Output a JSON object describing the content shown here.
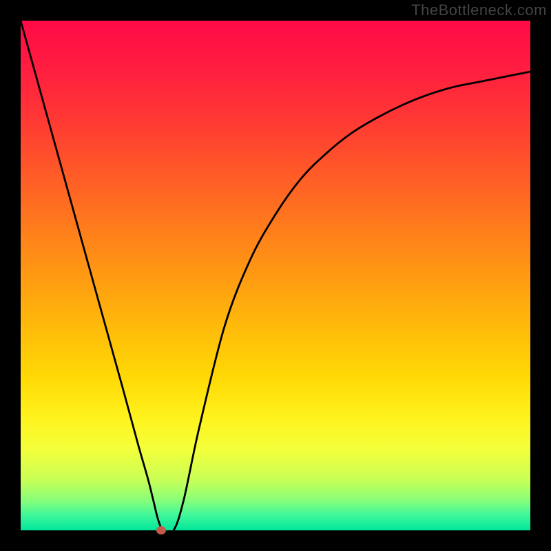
{
  "watermark": "TheBottleneck.com",
  "chart_data": {
    "type": "line",
    "title": "",
    "xlabel": "",
    "ylabel": "",
    "xlim": [
      0,
      100
    ],
    "ylim": [
      0,
      100
    ],
    "grid": false,
    "legend": false,
    "gradient_stops": [
      {
        "offset": 0.0,
        "color": "#ff0a47"
      },
      {
        "offset": 0.1,
        "color": "#ff1f3f"
      },
      {
        "offset": 0.2,
        "color": "#ff3a33"
      },
      {
        "offset": 0.3,
        "color": "#ff5a27"
      },
      {
        "offset": 0.4,
        "color": "#ff7a1c"
      },
      {
        "offset": 0.5,
        "color": "#ff9a12"
      },
      {
        "offset": 0.6,
        "color": "#ffba0a"
      },
      {
        "offset": 0.7,
        "color": "#ffd905"
      },
      {
        "offset": 0.78,
        "color": "#fff31d"
      },
      {
        "offset": 0.84,
        "color": "#f4ff3a"
      },
      {
        "offset": 0.9,
        "color": "#c9ff55"
      },
      {
        "offset": 0.94,
        "color": "#8aff78"
      },
      {
        "offset": 0.97,
        "color": "#40f79a"
      },
      {
        "offset": 1.0,
        "color": "#00e69b"
      }
    ],
    "series": [
      {
        "name": "bottleneck-curve",
        "stroke": "#000000",
        "stroke_width": 2.8,
        "x": [
          0,
          5,
          10,
          15,
          20,
          23,
          25,
          26,
          27,
          28,
          30,
          32,
          35,
          40,
          45,
          50,
          55,
          60,
          65,
          70,
          75,
          80,
          85,
          90,
          95,
          100
        ],
        "y": [
          100,
          82,
          64,
          46,
          28,
          17,
          10,
          6,
          2,
          0,
          0,
          6,
          20,
          40,
          53,
          62,
          69,
          74,
          78,
          81,
          83.5,
          85.5,
          87,
          88,
          89,
          90
        ]
      }
    ],
    "marker": {
      "name": "optimal-point",
      "x": 27.5,
      "y": 0,
      "color": "#c45a4a"
    }
  }
}
